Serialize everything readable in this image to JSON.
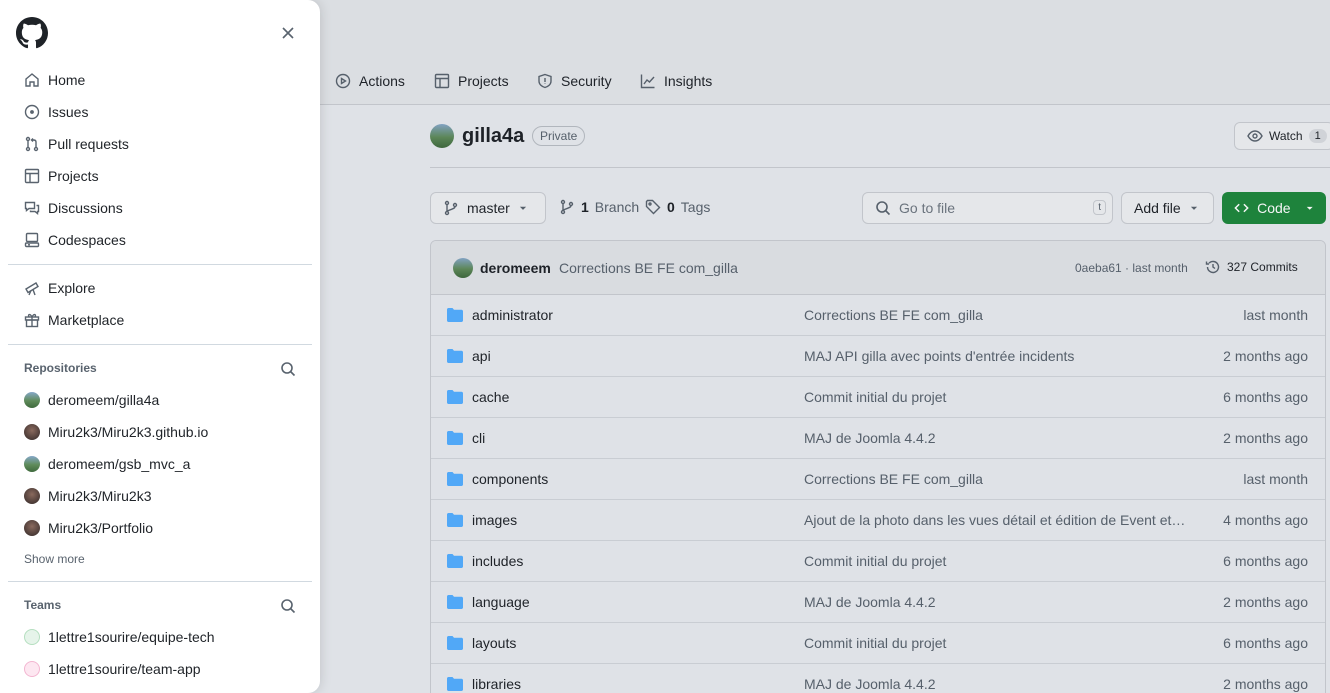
{
  "repo_nav": {
    "tabs": [
      {
        "label": "Actions",
        "icon": "play-icon"
      },
      {
        "label": "Projects",
        "icon": "table-icon"
      },
      {
        "label": "Security",
        "icon": "shield-icon"
      },
      {
        "label": "Insights",
        "icon": "graph-icon"
      }
    ]
  },
  "repo": {
    "name": "gilla4a",
    "visibility": "Private",
    "watch_label": "Watch",
    "watch_count": "1"
  },
  "toolbar": {
    "branch": "master",
    "branch_count": "1",
    "branch_label": "Branch",
    "tag_count": "0",
    "tag_label": "Tags",
    "go_to_file_placeholder": "Go to file",
    "go_to_file_shortcut": "t",
    "add_file_label": "Add file",
    "code_label": "Code"
  },
  "latest_commit": {
    "author": "deromeem",
    "message": "Corrections BE FE com_gilla",
    "hash_time": "0aeba61 · last month",
    "commits_label": "327 Commits"
  },
  "files": [
    {
      "name": "administrator",
      "message": "Corrections BE FE com_gilla",
      "date": "last month"
    },
    {
      "name": "api",
      "message": "MAJ API gilla avec points d'entrée incidents",
      "date": "2 months ago"
    },
    {
      "name": "cache",
      "message": "Commit initial du projet",
      "date": "6 months ago"
    },
    {
      "name": "cli",
      "message": "MAJ de Joomla 4.4.2",
      "date": "2 months ago"
    },
    {
      "name": "components",
      "message": "Corrections BE FE com_gilla",
      "date": "last month"
    },
    {
      "name": "images",
      "message": "Ajout de la photo dans les vues détail et édition de Event et…",
      "date": "4 months ago"
    },
    {
      "name": "includes",
      "message": "Commit initial du projet",
      "date": "6 months ago"
    },
    {
      "name": "language",
      "message": "MAJ de Joomla 4.4.2",
      "date": "2 months ago"
    },
    {
      "name": "layouts",
      "message": "Commit initial du projet",
      "date": "6 months ago"
    },
    {
      "name": "libraries",
      "message": "MAJ de Joomla 4.4.2",
      "date": "2 months ago"
    }
  ],
  "drawer": {
    "primary": [
      {
        "label": "Home",
        "icon": "home-icon"
      },
      {
        "label": "Issues",
        "icon": "issue-icon"
      },
      {
        "label": "Pull requests",
        "icon": "pull-request-icon"
      },
      {
        "label": "Projects",
        "icon": "table-icon"
      },
      {
        "label": "Discussions",
        "icon": "discussions-icon"
      },
      {
        "label": "Codespaces",
        "icon": "codespaces-icon"
      }
    ],
    "secondary": [
      {
        "label": "Explore",
        "icon": "telescope-icon"
      },
      {
        "label": "Marketplace",
        "icon": "gift-icon"
      }
    ],
    "repositories_title": "Repositories",
    "repositories": [
      {
        "label": "deromeem/gilla4a",
        "avatar": "landscape"
      },
      {
        "label": "Miru2k3/Miru2k3.github.io",
        "avatar": "portrait"
      },
      {
        "label": "deromeem/gsb_mvc_a",
        "avatar": "landscape"
      },
      {
        "label": "Miru2k3/Miru2k3",
        "avatar": "portrait"
      },
      {
        "label": "Miru2k3/Portfolio",
        "avatar": "portrait"
      }
    ],
    "show_more": "Show more",
    "teams_title": "Teams",
    "teams": [
      {
        "label": "1lettre1sourire/equipe-tech"
      },
      {
        "label": "1lettre1sourire/team-app"
      }
    ]
  },
  "colors": {
    "accent_green": "#1f883d",
    "folder_blue": "#54aeff"
  }
}
